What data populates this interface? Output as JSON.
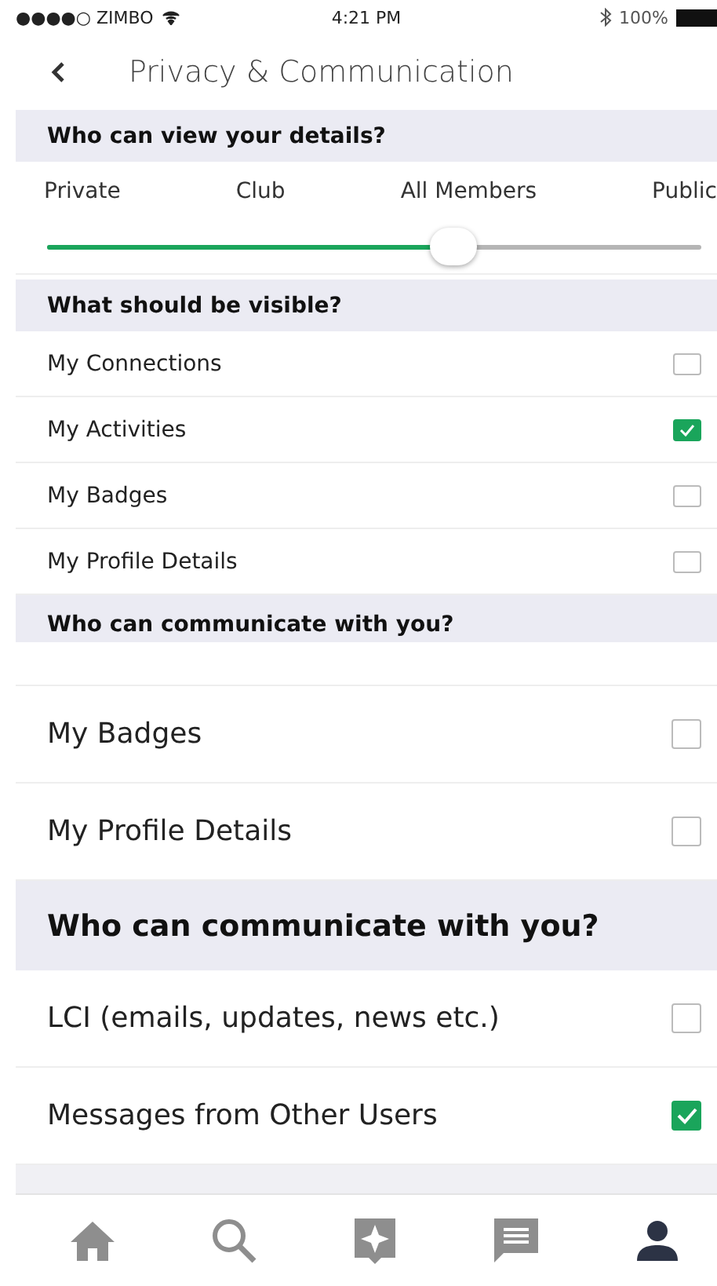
{
  "status_bar": {
    "carrier": "●●●●○ ZIMBO",
    "time": "4:21 PM",
    "battery": "100%"
  },
  "nav": {
    "title": "Privacy & Communication"
  },
  "view_details": {
    "heading": "Who can view your details?",
    "options": [
      {
        "label": "Private"
      },
      {
        "label": "Club"
      },
      {
        "label": "All Members"
      },
      {
        "label": "Public"
      }
    ],
    "level": 0.62
  },
  "visible": {
    "heading": "What should be visible?",
    "items": [
      {
        "label": "My Connections",
        "checked": false
      },
      {
        "label": "My Activities",
        "checked": true
      },
      {
        "label": "My Badges",
        "checked": false
      },
      {
        "label": "My Profile Details",
        "checked": false
      }
    ]
  },
  "communicate_heading": "Who can communicate with you?",
  "underlying_list": [
    {
      "kind": "row",
      "label": "My Badges",
      "checked": false
    },
    {
      "kind": "row",
      "label": "My Profile Details",
      "checked": false
    },
    {
      "kind": "header",
      "label": "Who can communicate with you?"
    },
    {
      "kind": "row",
      "label": "LCI (emails, updates, news etc.)",
      "checked": false
    },
    {
      "kind": "row",
      "label": "Messages from Other Users",
      "checked": true
    }
  ],
  "tab_bar": [
    {
      "selected": false
    },
    {
      "selected": false
    },
    {
      "selected": false
    },
    {
      "selected": false
    },
    {
      "selected": true
    }
  ]
}
